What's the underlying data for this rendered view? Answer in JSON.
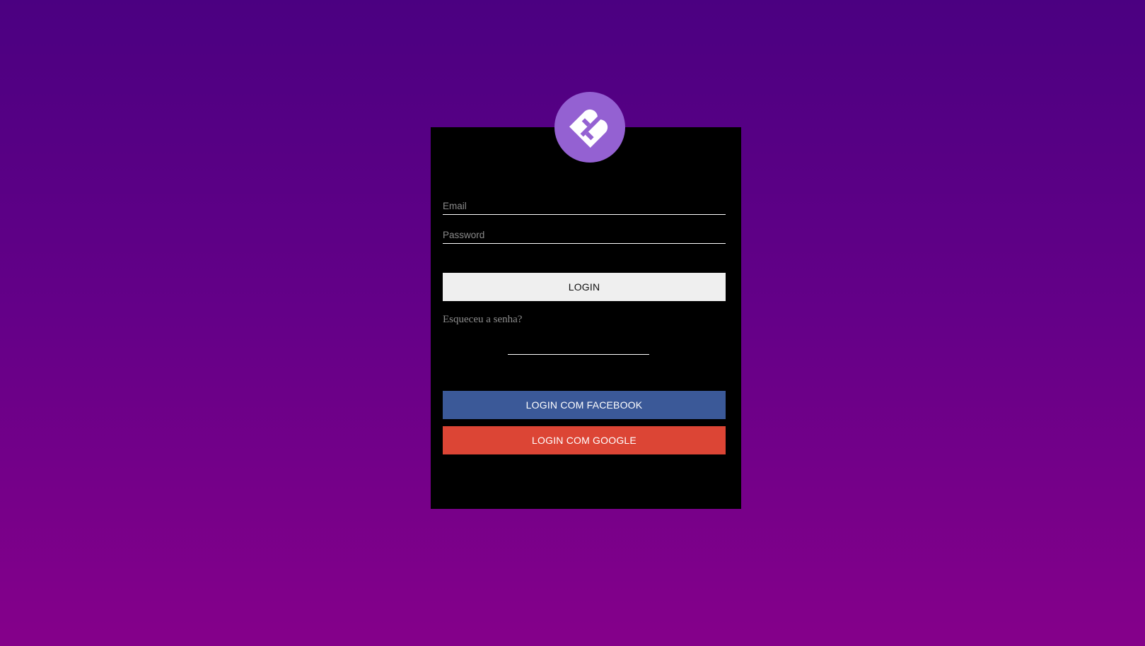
{
  "logo": {
    "icon": "heart-logo-icon",
    "bg_color": "#9461d2"
  },
  "form": {
    "email_placeholder": "Email",
    "email_value": "",
    "password_placeholder": "Password",
    "password_value": ""
  },
  "buttons": {
    "login_label": "LOGIN",
    "facebook_label": "LOGIN COM FACEBOOK",
    "google_label": "LOGIN COM GOOGLE"
  },
  "links": {
    "forgot_label": "Esqueceu a senha?"
  },
  "colors": {
    "background_top": "#4b0081",
    "background_bottom": "#85008a",
    "card": "#000000",
    "facebook": "#3b5998",
    "google": "#dc4535",
    "login_button": "#efefef"
  }
}
